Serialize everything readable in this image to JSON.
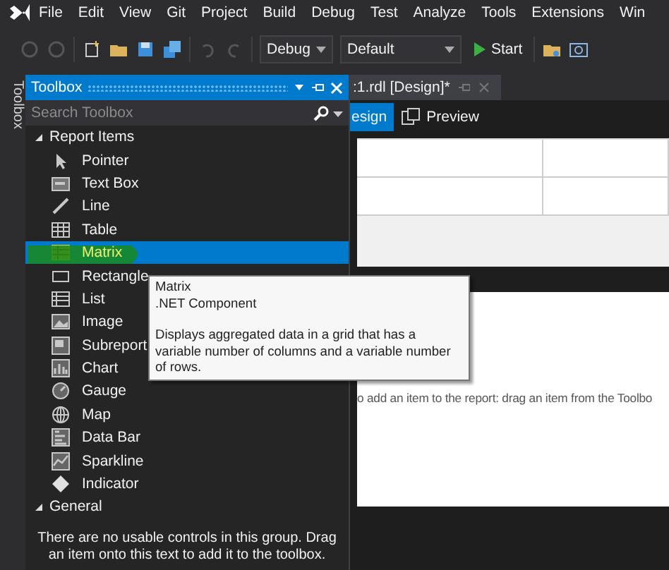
{
  "menu": [
    "File",
    "Edit",
    "View",
    "Git",
    "Project",
    "Build",
    "Debug",
    "Test",
    "Analyze",
    "Tools",
    "Extensions",
    "Win"
  ],
  "toolbar": {
    "configuration": "Debug",
    "platform": "Default",
    "start": "Start"
  },
  "side_tab": "Toolbox",
  "toolbox": {
    "title": "Toolbox",
    "search": {
      "placeholder": "Search Toolbox"
    },
    "groups": [
      {
        "label": "Report Items",
        "expanded": true,
        "items": [
          {
            "label": "Pointer",
            "selected": false
          },
          {
            "label": "Text Box",
            "selected": false
          },
          {
            "label": "Line",
            "selected": false
          },
          {
            "label": "Table",
            "selected": false
          },
          {
            "label": "Matrix",
            "selected": true
          },
          {
            "label": "Rectangle",
            "selected": false
          },
          {
            "label": "List",
            "selected": false
          },
          {
            "label": "Image",
            "selected": false
          },
          {
            "label": "Subreport",
            "selected": false
          },
          {
            "label": "Chart",
            "selected": false
          },
          {
            "label": "Gauge",
            "selected": false
          },
          {
            "label": "Map",
            "selected": false
          },
          {
            "label": "Data Bar",
            "selected": false
          },
          {
            "label": "Sparkline",
            "selected": false
          },
          {
            "label": "Indicator",
            "selected": false
          }
        ]
      },
      {
        "label": "General",
        "expanded": true,
        "message": "There are no usable controls in this group. Drag an item onto this text to add it to the toolbox."
      }
    ]
  },
  "document": {
    "tab": ":1.rdl [Design]*",
    "views": [
      {
        "label": "esign",
        "selected": true
      },
      {
        "label": "Preview",
        "selected": false
      }
    ],
    "hint": "o add an item to the report: drag an item from the Toolbo"
  },
  "tooltip": {
    "title": "Matrix",
    "subtitle": ".NET Component",
    "description": "Displays aggregated data in a grid that has a variable number of columns and a variable number of rows."
  }
}
